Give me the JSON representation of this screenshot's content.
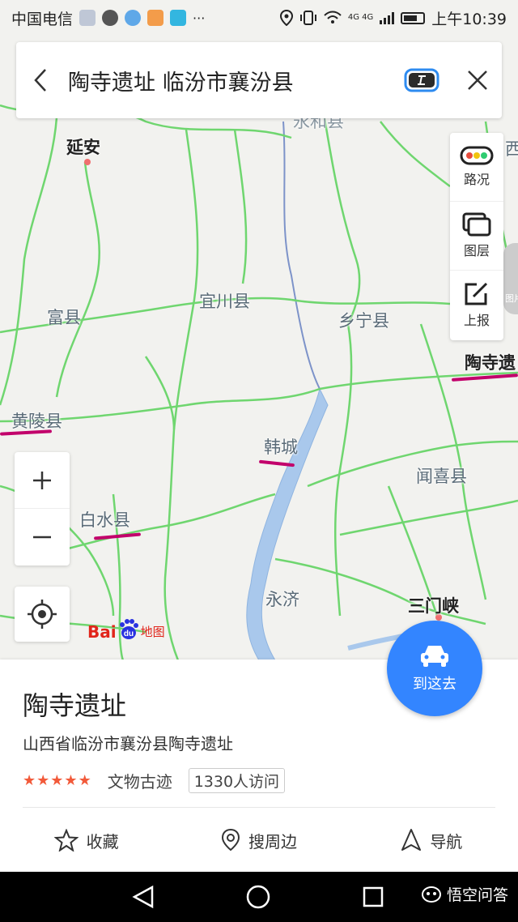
{
  "status_bar": {
    "carrier": "中国电信",
    "network": "4G 4G",
    "time": "上午10:39"
  },
  "search": {
    "query": "陶寺遗址 临汾市襄汾县"
  },
  "map": {
    "labels": [
      "延安",
      "富县",
      "宜川县",
      "乡宁县",
      "黄陵县",
      "韩城",
      "白水县",
      "闻喜县",
      "永济",
      "三门峡",
      "陶寺遗",
      "永和县",
      "西"
    ],
    "logo": {
      "bai": "Bai",
      "du": "du",
      "ditu": "地图"
    }
  },
  "tools": {
    "traffic": "路况",
    "layers": "图层",
    "report": "上报",
    "photo": "图片"
  },
  "go_button": {
    "label": "到这去"
  },
  "place": {
    "name": "陶寺遗址",
    "address": "山西省临汾市襄汾县陶寺遗址",
    "rating": 5,
    "category": "文物古迹",
    "visits": "1330人访问"
  },
  "actions": {
    "favorite": "收藏",
    "nearby": "搜周边",
    "navigate": "导航"
  },
  "watermark": "悟空问答",
  "colors": {
    "accent": "#3385ff",
    "road": "#6fd66f",
    "river": "#a9c8ec",
    "star": "#f25a3a",
    "annotation": "#c2006b"
  }
}
